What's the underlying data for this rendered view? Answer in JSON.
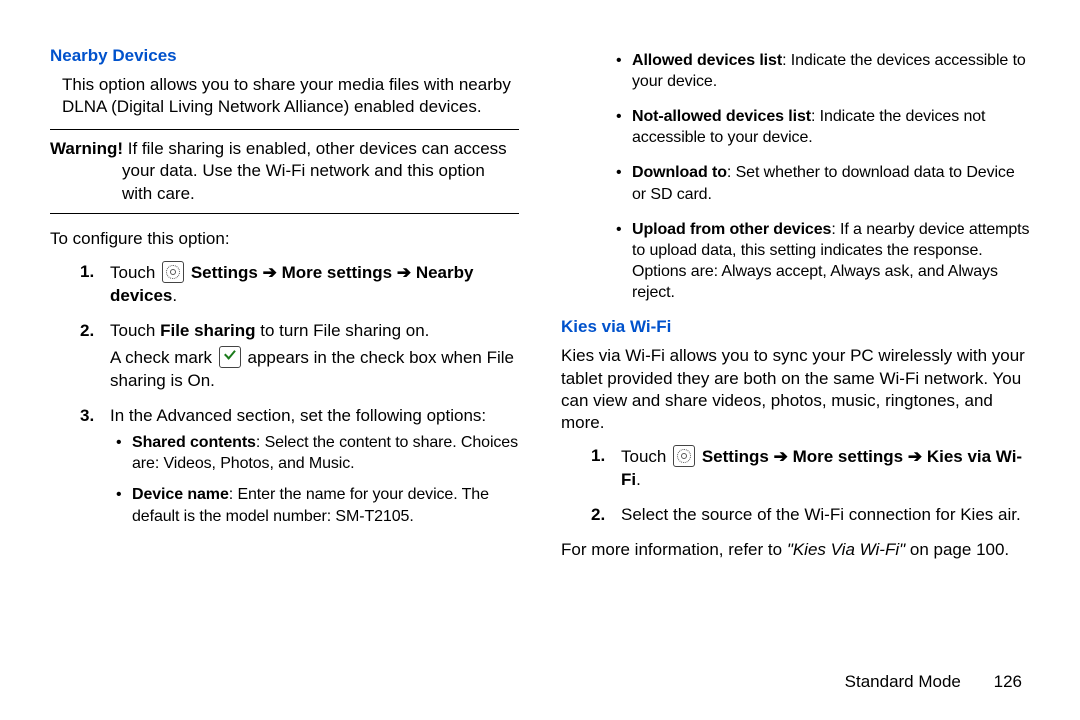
{
  "left": {
    "heading": "Nearby Devices",
    "intro": "This option allows you to share your media files with nearby DLNA (Digital Living Network Alliance) enabled devices.",
    "warn_label": "Warning!",
    "warn_body": " If file sharing is enabled, other devices can access your data. Use the Wi-Fi network and this option with care.",
    "configure": "To configure this option:",
    "steps": {
      "s1_num": "1.",
      "s1_a": "Touch ",
      "s1_b": " Settings ",
      "arrow": "➔",
      "s1_c": " More settings ",
      "s1_d": " Nearby devices",
      "s1_e": ".",
      "s2_num": "2.",
      "s2_a": "Touch ",
      "s2_b": "File sharing",
      "s2_c": " to turn File sharing on.",
      "s2_line2a": "A check mark ",
      "s2_line2b": " appears in the check box when File sharing is On.",
      "s3_num": "3.",
      "s3_text": "In the Advanced section, set the following options:",
      "b1_label": "Shared contents",
      "b1_text": ": Select the content to share. Choices are: Videos, Photos, and Music.",
      "b2_label": "Device name",
      "b2_text": ": Enter the name for your device. The default is the model number: SM-T2105."
    }
  },
  "right": {
    "bullets": {
      "b1_label": "Allowed devices list",
      "b1_text": ": Indicate the devices accessible to your device.",
      "b2_label": "Not-allowed devices list",
      "b2_text": ": Indicate the devices not accessible to your device.",
      "b3_label": "Download to",
      "b3_text": ": Set whether to download data to Device or SD card.",
      "b4_label": "Upload from other devices",
      "b4_text": ": If a nearby device attempts to upload data, this setting indicates the response. Options are: Always accept, Always ask, and Always reject."
    },
    "heading": "Kies via Wi-Fi",
    "intro": "Kies via Wi-Fi allows you to sync your PC wirelessly with your tablet provided they are both on the same Wi-Fi network. You can view and share videos, photos, music, ringtones, and more.",
    "steps": {
      "s1_num": "1.",
      "s1_a": "Touch ",
      "s1_b": " Settings ",
      "arrow": "➔",
      "s1_c": " More settings ",
      "s1_d": " Kies via Wi-Fi",
      "s1_e": ".",
      "s2_num": "2.",
      "s2_text": "Select the source of the Wi-Fi connection for Kies air."
    },
    "more_a": "For more information, refer to ",
    "more_ital": "\"Kies Via Wi-Fi\"",
    "more_b": " on page 100."
  },
  "footer": {
    "section": "Standard Mode",
    "page": "126"
  }
}
